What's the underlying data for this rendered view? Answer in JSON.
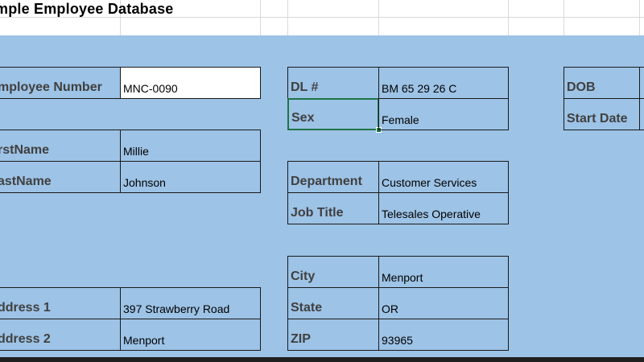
{
  "sheet": {
    "title": "mple Employee Database"
  },
  "fields": {
    "employee_number": {
      "label": "mployee Number",
      "value": "MNC-0090"
    },
    "first_name": {
      "label": "rstName",
      "value": "Millie"
    },
    "last_name": {
      "label": "astName",
      "value": "Johnson"
    },
    "address1": {
      "label": "ddress 1",
      "value": "397 Strawberry Road"
    },
    "address2": {
      "label": "ddress 2",
      "value": "Menport"
    },
    "dl": {
      "label": "DL #",
      "value": "BM 65 29 26 C"
    },
    "sex": {
      "label": "Sex",
      "value": "Female"
    },
    "department": {
      "label": "Department",
      "value": "Customer Services"
    },
    "job_title": {
      "label": "Job Title",
      "value": "Telesales Operative"
    },
    "city": {
      "label": "City",
      "value": "Menport"
    },
    "state": {
      "label": "State",
      "value": "OR"
    },
    "zip": {
      "label": "ZIP",
      "value": "93965"
    },
    "dob": {
      "label": "DOB",
      "value": ""
    },
    "start_date": {
      "label": "Start Date",
      "value": ""
    }
  },
  "colors": {
    "form_background": "#9dc3e6",
    "selection": "#217346"
  }
}
